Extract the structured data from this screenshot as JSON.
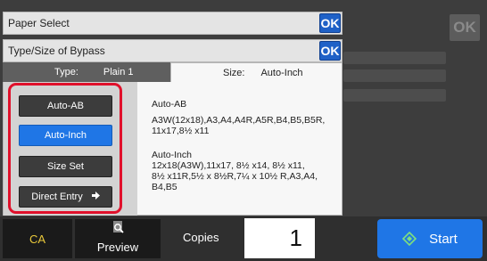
{
  "header": {
    "paper_select": "Paper Select",
    "bypass_title": "Type/Size of Bypass",
    "ok_label": "OK"
  },
  "tabs": {
    "type_label": "Type:",
    "type_value": "Plain 1",
    "size_label": "Size:",
    "size_value": "Auto-Inch"
  },
  "size_buttons": [
    {
      "label": "Auto-AB"
    },
    {
      "label": "Auto-Inch"
    },
    {
      "label": "Size Set"
    },
    {
      "label": "Direct Entry"
    }
  ],
  "descriptions": {
    "auto_ab_title": "Auto-AB",
    "auto_ab_sizes_line1": "A3W(12x18),A3,A4,A4R,A5R,B4,B5,B5R,",
    "auto_ab_sizes_line2": "11x17,8½ x11",
    "auto_inch_title": "Auto-Inch",
    "auto_inch_sizes_line1": "12x18(A3W),11x17, 8½ x14, 8½ x11,",
    "auto_inch_sizes_line2": "8½ x11R,5½ x 8½R,7¼ x 10½ R,A3,A4,",
    "auto_inch_sizes_line3": "B4,B5"
  },
  "bottom": {
    "ca_label": "CA",
    "preview_label": "Preview",
    "copies_label": "Copies",
    "copies_value": "1",
    "start_label": "Start"
  },
  "background": {
    "ok_label": "OK"
  },
  "colors": {
    "accent_blue": "#1f76e6",
    "highlight_red": "#e0102b",
    "ca_yellow": "#e9c83a"
  }
}
